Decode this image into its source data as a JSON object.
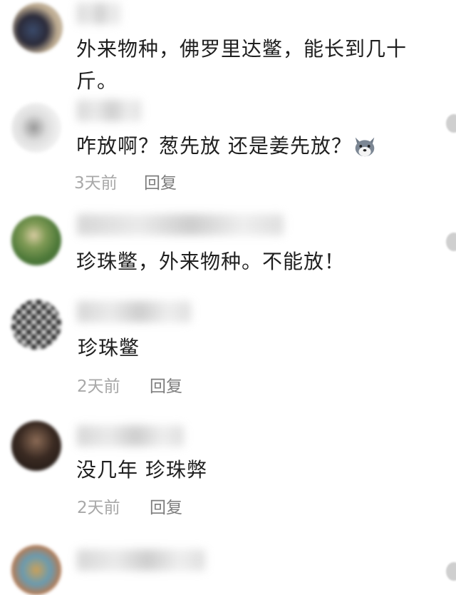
{
  "comments": [
    {
      "text_lines": [
        "外来物种，佛罗里达鳖，能长到几十",
        "斤。"
      ]
    },
    {
      "text": "咋放啊？葱先放 还是姜先放？",
      "emoji": "dog-face-emoji",
      "time": "3天前",
      "reply_label": "回复"
    },
    {
      "text": "珍珠鳖，外来物种。不能放！"
    },
    {
      "text": "珍珠鳖",
      "time": "2天前",
      "reply_label": "回复"
    },
    {
      "text": "没几年 珍珠弊",
      "time": "2天前",
      "reply_label": "回复"
    },
    {}
  ],
  "colors": {
    "text": "#1f1f1f",
    "meta": "#a8a8a8",
    "reply": "#7d7d7d",
    "blur": "#cccccc"
  }
}
